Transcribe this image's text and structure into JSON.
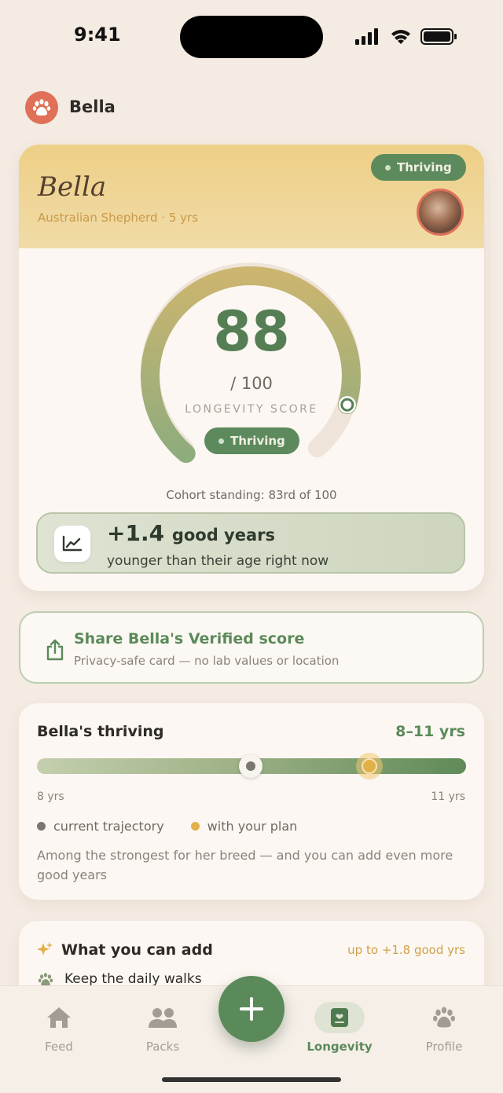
{
  "status_bar": {
    "time": "9:41"
  },
  "header": {
    "pet_name": "Bella"
  },
  "score_card": {
    "pet_title": "Bella",
    "breed_age": "Australian Shepherd · 5 yrs",
    "status_badge": "Thriving",
    "score": "88",
    "score_value": 88,
    "score_out_of": "/ 100",
    "score_label": "LONGEVITY SCORE",
    "gauge_badge": "Thriving",
    "cohort": "Cohort standing: 83rd of 100",
    "years_big": "+1.4",
    "years_unit": "good years",
    "years_sub": "younger than their age right now"
  },
  "share_card": {
    "title": "Share Bella's Verified score",
    "subtitle": "Privacy-safe card — no lab values or location"
  },
  "thriving_card": {
    "title": "Bella's thriving",
    "range": "8–11 yrs",
    "min_label": "8 yrs",
    "max_label": "11 yrs",
    "current_trajectory_yrs": 9.5,
    "with_plan_yrs": 10.2,
    "legend_current": "current trajectory",
    "legend_plan": "with your plan",
    "note": "Among the strongest for her breed — and you can add even more good years",
    "colors": {
      "current": "#7b7770",
      "plan": "#e2b048"
    }
  },
  "add_card": {
    "title": "What you can add",
    "amount": "up to +1.8 good yrs",
    "item": "Keep the daily walks"
  },
  "tabbar": {
    "tabs": [
      {
        "label": "Feed",
        "icon": "home-icon"
      },
      {
        "label": "Packs",
        "icon": "people-icon"
      },
      {
        "label": "Longevity",
        "icon": "longevity-icon",
        "active": true
      },
      {
        "label": "Profile",
        "icon": "paw-icon"
      }
    ],
    "fab_icon": "plus-icon"
  },
  "colors": {
    "accent": "#5b8a5a",
    "gold": "#e2b048",
    "coral": "#e07058",
    "background": "#f4ebe2"
  }
}
